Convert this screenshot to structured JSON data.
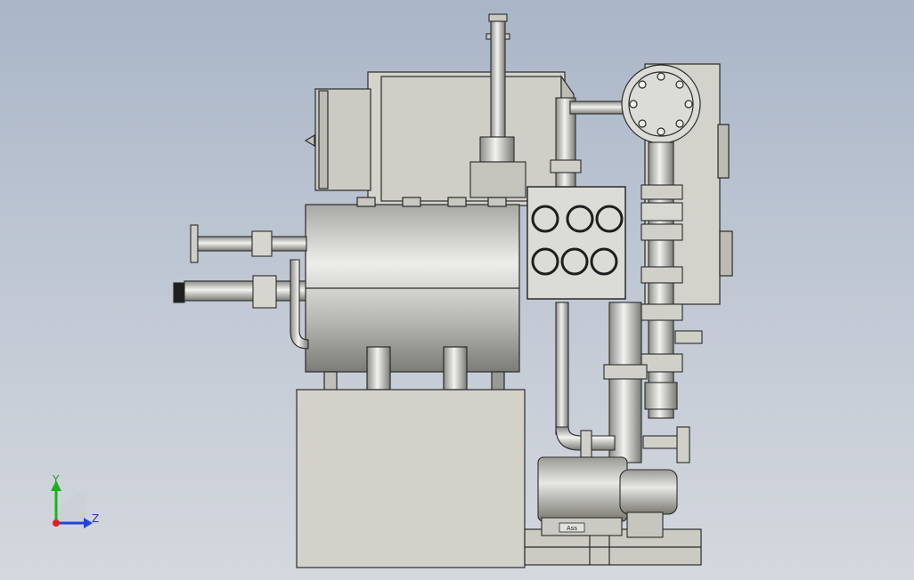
{
  "triad": {
    "y_label": "Y",
    "z_label": "Z",
    "colors": {
      "y": "#19b319",
      "z": "#2244dd",
      "x": "#dd2222"
    }
  },
  "motor": {
    "nameplate": "Ass"
  },
  "colors": {
    "background_top": "#a9b6c8",
    "background_bottom": "#d4d8de",
    "metal": "#d6d6cf",
    "edge": "#2a2a2a"
  }
}
